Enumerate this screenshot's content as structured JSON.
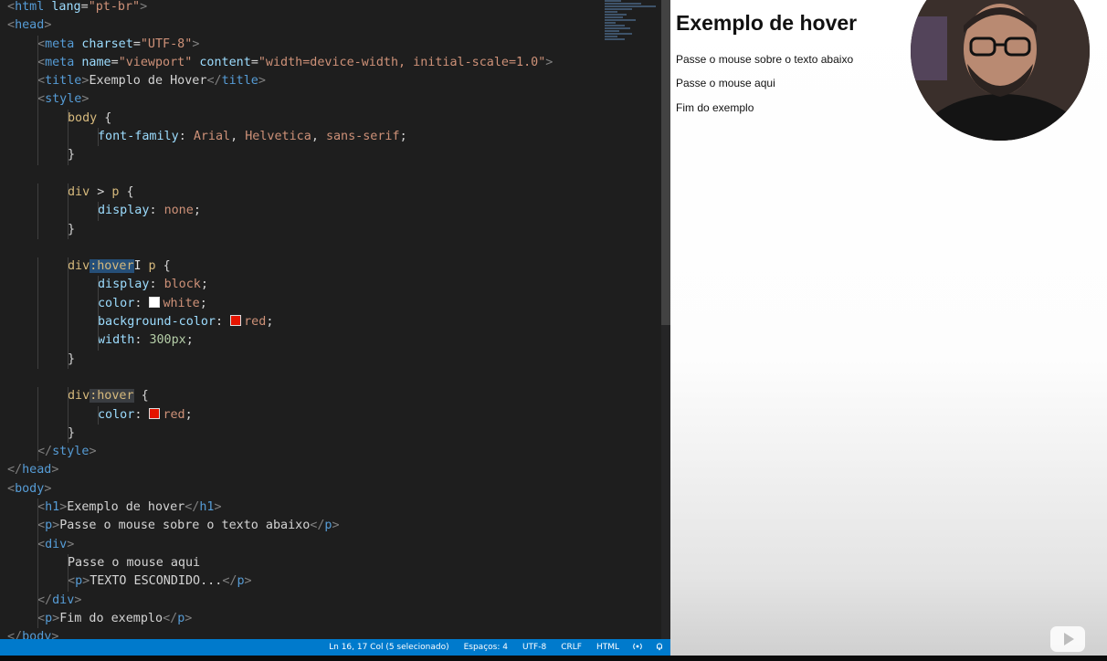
{
  "editor": {
    "code_lines": [
      {
        "indent": 0,
        "tokens": [
          [
            "pn",
            "<"
          ],
          [
            "tg",
            "html"
          ],
          [
            "tx",
            " "
          ],
          [
            "at",
            "lang"
          ],
          [
            "tx",
            "="
          ],
          [
            "st",
            "\"pt-br\""
          ],
          [
            "pn",
            ">"
          ]
        ]
      },
      {
        "indent": 0,
        "tokens": [
          [
            "pn",
            "<"
          ],
          [
            "tg",
            "head"
          ],
          [
            "pn",
            ">"
          ]
        ]
      },
      {
        "indent": 1,
        "tokens": [
          [
            "pn",
            "<"
          ],
          [
            "tg",
            "meta"
          ],
          [
            "tx",
            " "
          ],
          [
            "at",
            "charset"
          ],
          [
            "tx",
            "="
          ],
          [
            "st",
            "\"UTF-8\""
          ],
          [
            "pn",
            ">"
          ]
        ]
      },
      {
        "indent": 1,
        "tokens": [
          [
            "pn",
            "<"
          ],
          [
            "tg",
            "meta"
          ],
          [
            "tx",
            " "
          ],
          [
            "at",
            "name"
          ],
          [
            "tx",
            "="
          ],
          [
            "st",
            "\"viewport\""
          ],
          [
            "tx",
            " "
          ],
          [
            "at",
            "content"
          ],
          [
            "tx",
            "="
          ],
          [
            "st",
            "\"width=device-width, initial-scale=1.0\""
          ],
          [
            "pn",
            ">"
          ]
        ]
      },
      {
        "indent": 1,
        "tokens": [
          [
            "pn",
            "<"
          ],
          [
            "tg",
            "title"
          ],
          [
            "pn",
            ">"
          ],
          [
            "tx",
            "Exemplo de Hover"
          ],
          [
            "pn",
            "</"
          ],
          [
            "tg",
            "title"
          ],
          [
            "pn",
            ">"
          ]
        ]
      },
      {
        "indent": 1,
        "tokens": [
          [
            "pn",
            "<"
          ],
          [
            "tg",
            "style"
          ],
          [
            "pn",
            ">"
          ]
        ]
      },
      {
        "indent": 2,
        "tokens": [
          [
            "sel",
            "body"
          ],
          [
            "tx",
            " {"
          ]
        ]
      },
      {
        "indent": 3,
        "tokens": [
          [
            "pr",
            "font-family"
          ],
          [
            "tx",
            ": "
          ],
          [
            "vl",
            "Arial"
          ],
          [
            "tx",
            ", "
          ],
          [
            "vl",
            "Helvetica"
          ],
          [
            "tx",
            ", "
          ],
          [
            "vl",
            "sans-serif"
          ],
          [
            "tx",
            ";"
          ]
        ]
      },
      {
        "indent": 2,
        "tokens": [
          [
            "tx",
            "}"
          ]
        ]
      },
      {
        "indent": 0,
        "tokens": []
      },
      {
        "indent": 2,
        "tokens": [
          [
            "sel",
            "div"
          ],
          [
            "tx",
            " > "
          ],
          [
            "sel",
            "p"
          ],
          [
            "tx",
            " {"
          ]
        ]
      },
      {
        "indent": 3,
        "tokens": [
          [
            "pr",
            "display"
          ],
          [
            "tx",
            ": "
          ],
          [
            "vl",
            "none"
          ],
          [
            "tx",
            ";"
          ]
        ]
      },
      {
        "indent": 2,
        "tokens": [
          [
            "tx",
            "}"
          ]
        ]
      },
      {
        "indent": 0,
        "tokens": []
      },
      {
        "indent": 2,
        "tokens": [
          [
            "sel",
            "div"
          ],
          [
            "selhl",
            ":hover"
          ],
          [
            "cursor",
            "I"
          ],
          [
            "tx",
            " "
          ],
          [
            "sel",
            "p"
          ],
          [
            "tx",
            " {"
          ]
        ]
      },
      {
        "indent": 3,
        "tokens": [
          [
            "pr",
            "display"
          ],
          [
            "tx",
            ": "
          ],
          [
            "vl",
            "block"
          ],
          [
            "tx",
            ";"
          ]
        ]
      },
      {
        "indent": 3,
        "tokens": [
          [
            "pr",
            "color"
          ],
          [
            "tx",
            ": "
          ],
          [
            "swatch",
            "#ffffff"
          ],
          [
            "vl",
            "white"
          ],
          [
            "tx",
            ";"
          ]
        ]
      },
      {
        "indent": 3,
        "tokens": [
          [
            "pr",
            "background-color"
          ],
          [
            "tx",
            ": "
          ],
          [
            "swatch",
            "#e51400"
          ],
          [
            "vl",
            "red"
          ],
          [
            "tx",
            ";"
          ]
        ]
      },
      {
        "indent": 3,
        "tokens": [
          [
            "pr",
            "width"
          ],
          [
            "tx",
            ": "
          ],
          [
            "nm",
            "300px"
          ],
          [
            "tx",
            ";"
          ]
        ]
      },
      {
        "indent": 2,
        "tokens": [
          [
            "tx",
            "}"
          ]
        ]
      },
      {
        "indent": 0,
        "tokens": []
      },
      {
        "indent": 2,
        "tokens": [
          [
            "sel",
            "div"
          ],
          [
            "selhl2",
            ":hover"
          ],
          [
            "tx",
            " {"
          ]
        ]
      },
      {
        "indent": 3,
        "tokens": [
          [
            "pr",
            "color"
          ],
          [
            "tx",
            ": "
          ],
          [
            "swatch",
            "#e51400"
          ],
          [
            "vl",
            "red"
          ],
          [
            "tx",
            ";"
          ]
        ]
      },
      {
        "indent": 2,
        "tokens": [
          [
            "tx",
            "}"
          ]
        ]
      },
      {
        "indent": 1,
        "tokens": [
          [
            "pn",
            "</"
          ],
          [
            "tg",
            "style"
          ],
          [
            "pn",
            ">"
          ]
        ]
      },
      {
        "indent": 0,
        "tokens": [
          [
            "pn",
            "</"
          ],
          [
            "tg",
            "head"
          ],
          [
            "pn",
            ">"
          ]
        ]
      },
      {
        "indent": 0,
        "tokens": [
          [
            "pn",
            "<"
          ],
          [
            "tg",
            "body"
          ],
          [
            "pn",
            ">"
          ]
        ]
      },
      {
        "indent": 1,
        "tokens": [
          [
            "pn",
            "<"
          ],
          [
            "tg",
            "h1"
          ],
          [
            "pn",
            ">"
          ],
          [
            "tx",
            "Exemplo de hover"
          ],
          [
            "pn",
            "</"
          ],
          [
            "tg",
            "h1"
          ],
          [
            "pn",
            ">"
          ]
        ]
      },
      {
        "indent": 1,
        "tokens": [
          [
            "pn",
            "<"
          ],
          [
            "tg",
            "p"
          ],
          [
            "pn",
            ">"
          ],
          [
            "tx",
            "Passe o mouse sobre o texto abaixo"
          ],
          [
            "pn",
            "</"
          ],
          [
            "tg",
            "p"
          ],
          [
            "pn",
            ">"
          ]
        ]
      },
      {
        "indent": 1,
        "tokens": [
          [
            "pn",
            "<"
          ],
          [
            "tg",
            "div"
          ],
          [
            "pn",
            ">"
          ]
        ]
      },
      {
        "indent": 2,
        "tokens": [
          [
            "tx",
            "Passe o mouse aqui"
          ]
        ]
      },
      {
        "indent": 2,
        "tokens": [
          [
            "pn",
            "<"
          ],
          [
            "tg",
            "p"
          ],
          [
            "pn",
            ">"
          ],
          [
            "tx",
            "TEXTO ESCONDIDO..."
          ],
          [
            "pn",
            "</"
          ],
          [
            "tg",
            "p"
          ],
          [
            "pn",
            ">"
          ]
        ]
      },
      {
        "indent": 1,
        "tokens": [
          [
            "pn",
            "</"
          ],
          [
            "tg",
            "div"
          ],
          [
            "pn",
            ">"
          ]
        ]
      },
      {
        "indent": 1,
        "tokens": [
          [
            "pn",
            "<"
          ],
          [
            "tg",
            "p"
          ],
          [
            "pn",
            ">"
          ],
          [
            "tx",
            "Fim do exemplo"
          ],
          [
            "pn",
            "</"
          ],
          [
            "tg",
            "p"
          ],
          [
            "pn",
            ">"
          ]
        ]
      },
      {
        "indent": 0,
        "tokens": [
          [
            "pn",
            "</"
          ],
          [
            "tg",
            "body"
          ],
          [
            "pn",
            ">"
          ]
        ]
      }
    ]
  },
  "statusbar": {
    "cursor_position": "Ln 16, 17 Col (5 selecionado)",
    "indentation": "Espaços: 4",
    "encoding": "UTF-8",
    "line_ending": "CRLF",
    "language": "HTML",
    "icons": [
      "broadcast-icon",
      "bell-icon"
    ]
  },
  "preview": {
    "heading": "Exemplo de hover",
    "paragraph_1": "Passe o mouse sobre o texto abaixo",
    "div_text": "Passe o mouse aqui",
    "paragraph_2": "Fim do exemplo"
  },
  "colors": {
    "statusbar_bg": "#007acc",
    "editor_bg": "#1e1e1e",
    "swatch_red": "#e51400",
    "swatch_white": "#ffffff"
  }
}
